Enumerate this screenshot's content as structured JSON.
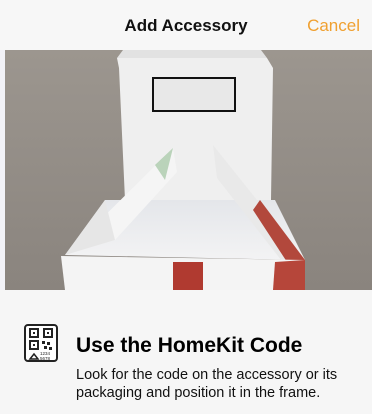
{
  "nav": {
    "title": "Add Accessory",
    "cancel_label": "Cancel",
    "accent_color": "#f0a030"
  },
  "viewfinder": {
    "scan_frame": "homekit-code-frame"
  },
  "instructions": {
    "icon": "homekit-setup-code-icon",
    "icon_code_line1": "1234",
    "icon_code_line2": "5678",
    "heading": "Use the HomeKit Code",
    "body": "Look for the code on the accessory or its packaging and position it in the frame."
  }
}
